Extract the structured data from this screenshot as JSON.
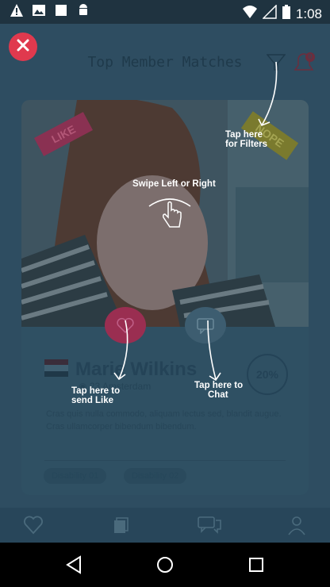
{
  "status": {
    "time": "1:08"
  },
  "header": {
    "title": "Top Member Matches",
    "notification_count": "0"
  },
  "card": {
    "like_stamp": "LIKE",
    "nope_stamp": "NOPE",
    "name": "Marie Wilkins",
    "location": "23 Amsterdam",
    "match_percent": "20%",
    "description": "Cras quis nulla commodo, aliquam lectus sed, blandit augue. Cras ullamcorper bibendum bibendum.",
    "tags": [
      "Disability 01",
      "Disability 02"
    ]
  },
  "tutorial": {
    "filters_hint": [
      "Tap here",
      "for Filters"
    ],
    "swipe_hint": "Swipe Left or Right",
    "like_hint": [
      "Tap here to",
      "send Like"
    ],
    "chat_hint": [
      "Tap here to",
      "Chat"
    ]
  },
  "colors": {
    "overlay": "#2e4d61",
    "accent_red": "#e0394e",
    "like_pink": "#9a2e51"
  }
}
